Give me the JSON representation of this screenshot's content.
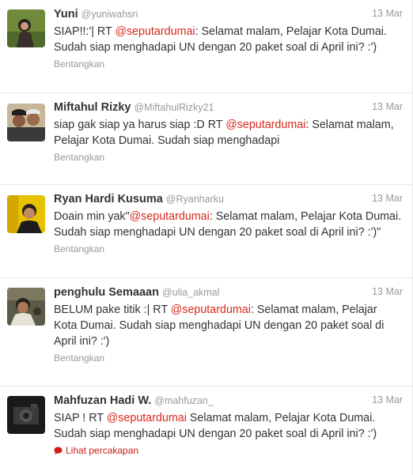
{
  "tweets": [
    {
      "name": "Yuni",
      "handle": "@yuniwahsri",
      "time": "13 Mar",
      "before": "SIAP!!:'| RT ",
      "mention": "@seputardumai",
      "after": ": Selamat malam, Pelajar Kota Dumai. Sudah siap menghadapi UN dengan 20 paket soal di April ini? :')",
      "action": "Bentangkan"
    },
    {
      "name": "Miftahul Rizky",
      "handle": "@MiftahulRizky21",
      "time": "13 Mar",
      "before": "siap gak siap ya harus siap :D RT ",
      "mention": "@seputardumai",
      "after": ": Selamat malam, Pelajar Kota Dumai. Sudah siap menghadapi",
      "action": "Bentangkan"
    },
    {
      "name": "Ryan Hardi Kusuma",
      "handle": "@Ryanharku",
      "time": "13 Mar",
      "before": "Doain min yak\"",
      "mention": "@seputardumai",
      "after": ": Selamat malam, Pelajar Kota Dumai. Sudah siap menghadapi UN dengan 20 paket soal di April ini? :')\"",
      "action": "Bentangkan"
    },
    {
      "name": "penghulu Semaaan",
      "handle": "@ulia_akmal",
      "time": "13 Mar",
      "before": "BELUM pake titik :| RT ",
      "mention": "@seputardumai",
      "after": ": Selamat malam, Pelajar Kota Dumai. Sudah siap menghadapi UN dengan 20 paket soal di April ini? :')",
      "action": "Bentangkan"
    },
    {
      "name": "Mahfuzan Hadi W.",
      "handle": "@mahfuzan_",
      "time": "13 Mar",
      "before": "SIAP ! RT ",
      "mention": "@seputardumai",
      "after": " Selamat malam, Pelajar Kota Dumai. Sudah siap menghadapi UN dengan 20 paket soal di April ini? :')",
      "action": "Lihat percakapan"
    }
  ],
  "colors": {
    "mention": "#d8281c",
    "meta": "#999999",
    "conversation_link": "#cc1f18"
  },
  "icons": {
    "conversation": "speech-bubble-icon"
  }
}
